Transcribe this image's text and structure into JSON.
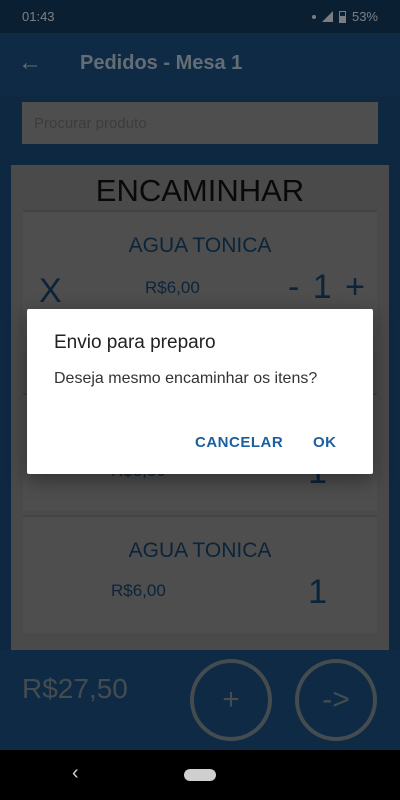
{
  "status_bar": {
    "time": "01:43",
    "battery": "53%"
  },
  "header": {
    "title": "Pedidos - Mesa 1",
    "back_icon": "arrow-left-icon"
  },
  "search": {
    "placeholder": "Procurar produto"
  },
  "forward_panel": {
    "title": "ENCAMINHAR",
    "item": {
      "name": "AGUA TONICA",
      "price": "R$6,00",
      "remove": "X",
      "minus": "-",
      "quantity": "1",
      "plus": "+"
    }
  },
  "order_list": [
    {
      "name": "",
      "price": "R$3,50",
      "quantity": "1"
    },
    {
      "name": "AGUA TONICA",
      "price": "R$6,00",
      "quantity": "1"
    }
  ],
  "footer": {
    "total": "R$27,50",
    "add_label": "+",
    "send_label": "->"
  },
  "dialog": {
    "title": "Envio para preparo",
    "message": "Deseja mesmo encaminhar os itens?",
    "cancel_label": "CANCELAR",
    "ok_label": "OK"
  },
  "colors": {
    "primary": "#1b4e7d",
    "status_bar": "#14395c",
    "accent": "#1b5fa0"
  }
}
